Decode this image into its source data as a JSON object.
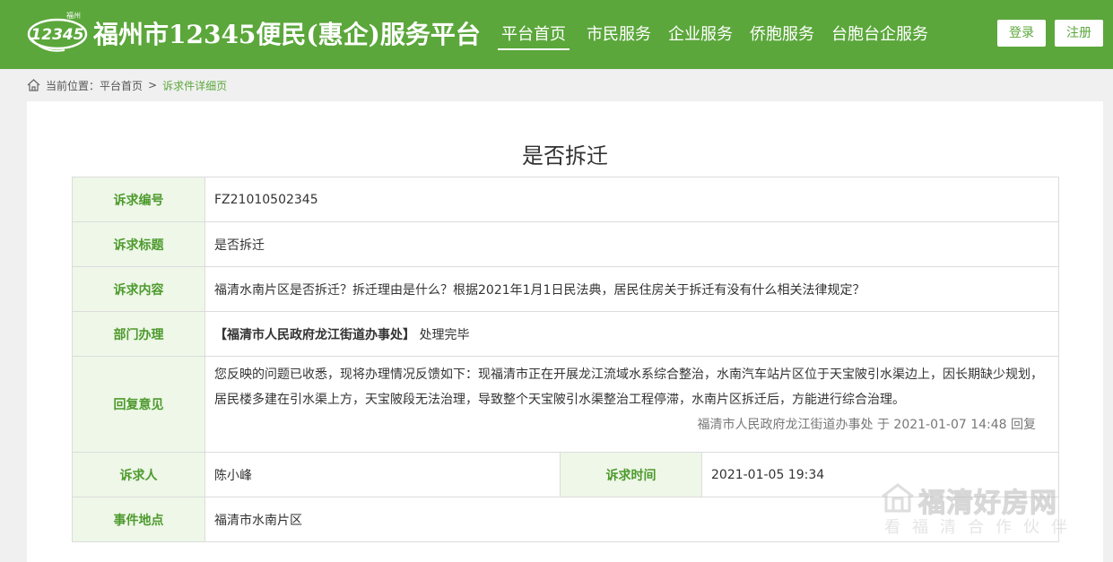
{
  "header": {
    "logo_small_text": "福州",
    "logo_number": "12345",
    "title": "福州市12345便民(惠企)服务平台",
    "nav": [
      "平台首页",
      "市民服务",
      "企业服务",
      "侨胞服务",
      "台胞台企服务"
    ],
    "login": "登录",
    "register": "注册",
    "brand_color": "#5ba73b"
  },
  "breadcrumb": {
    "prefix": "当前位置：",
    "home": "平台首页",
    "separator": ">",
    "current": "诉求件详细页"
  },
  "detail": {
    "page_title": "是否拆迁",
    "labels": {
      "id": "诉求编号",
      "title": "诉求标题",
      "content": "诉求内容",
      "dept": "部门办理",
      "reply": "回复意见",
      "person": "诉求人",
      "time": "诉求时间",
      "location": "事件地点"
    },
    "values": {
      "id": "FZ21010502345",
      "title": "是否拆迁",
      "content": "福清水南片区是否拆迁？拆迁理由是什么？根据2021年1月1日民法典，居民住房关于拆迁有没有什么相关法律规定？",
      "dept_name": "【福清市人民政府龙江街道办事处】",
      "dept_status": "处理完毕",
      "reply_text": "您反映的问题已收悉，现将办理情况反馈如下：现福清市正在开展龙江流域水系综合整治，水南汽车站片区位于天宝陂引水渠边上，因长期缺少规划，居民楼多建在引水渠上方，天宝陂段无法治理，导致整个天宝陂引水渠整治工程停滞，水南片区拆迁后，方能进行综合治理。",
      "reply_meta": "福清市人民政府龙江街道办事处 于 2021-01-07 14:48 回复",
      "person": "陈小峰",
      "time": "2021-01-05 19:34",
      "location": "福清市水南片区"
    }
  },
  "watermark": {
    "big": "福清好房网",
    "small": "看福清合作伙伴"
  }
}
